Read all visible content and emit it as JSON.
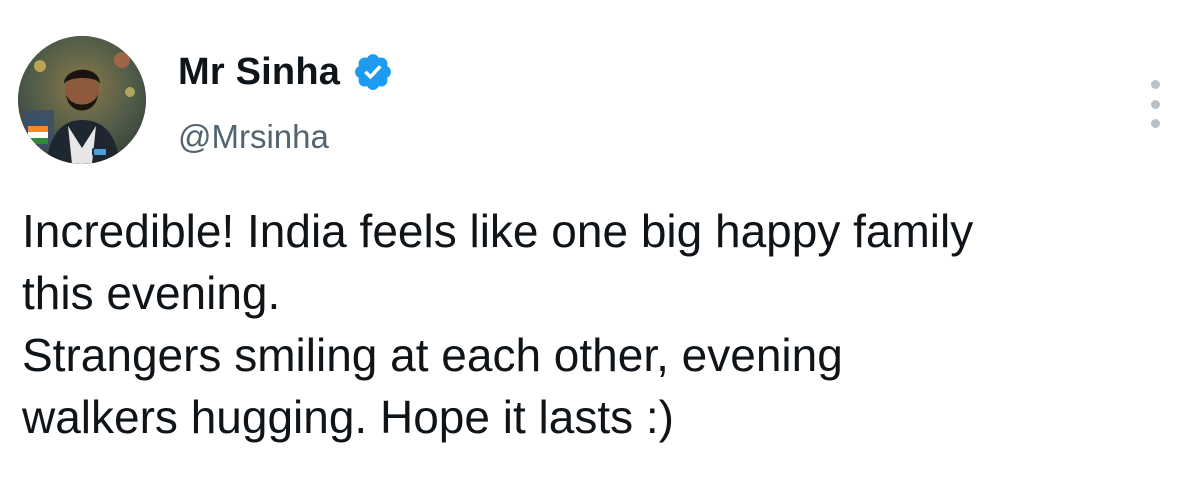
{
  "tweet": {
    "author": {
      "display_name": "Mr Sinha",
      "handle": "@Mrsinha",
      "verified": true,
      "verified_color": "#1d9bf0"
    },
    "more_icon": "more-vertical-icon",
    "text_lines": [
      "Incredible! India feels like one big happy family",
      "this evening.",
      "Strangers smiling at each other, evening",
      "walkers hugging. Hope it lasts :)"
    ]
  },
  "colors": {
    "text_primary": "#0f1419",
    "text_secondary": "#536471",
    "background": "#ffffff"
  }
}
